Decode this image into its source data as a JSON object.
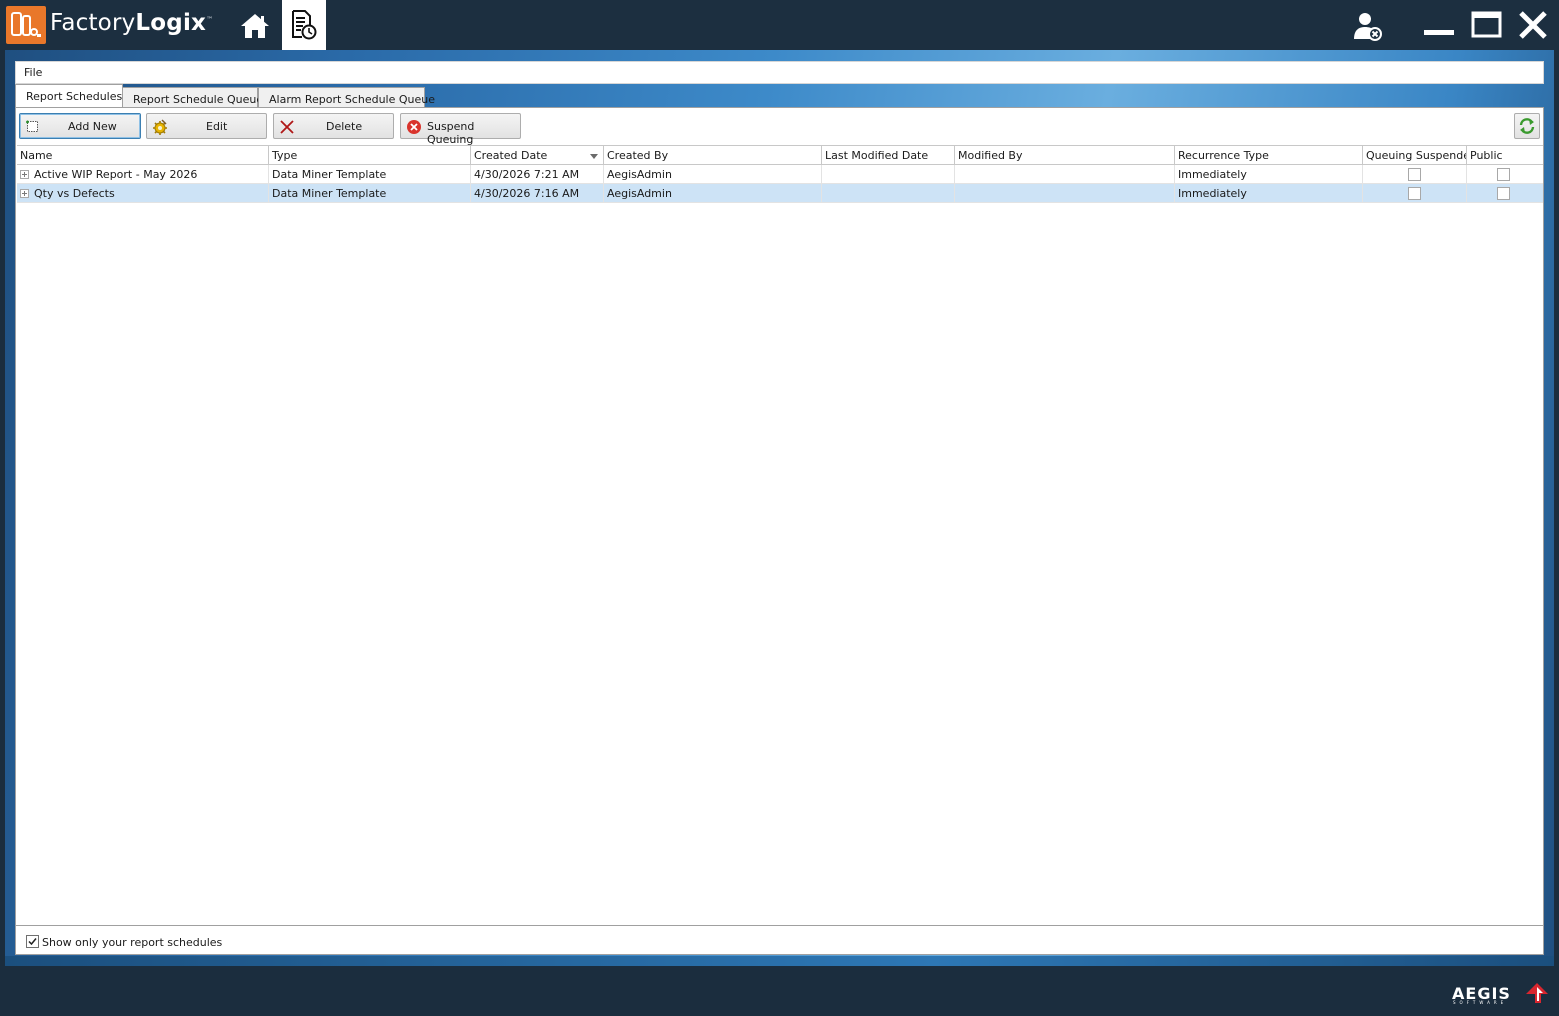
{
  "app": {
    "brand_light": "Factory",
    "brand_bold": "Logix",
    "brand_tm": "™"
  },
  "menu": {
    "file_label": "File"
  },
  "tabs": [
    {
      "label": "Report Schedules",
      "active": true
    },
    {
      "label": "Report Schedule Queue",
      "active": false
    },
    {
      "label": "Alarm Report Schedule Queue",
      "active": false
    }
  ],
  "toolbar": {
    "add_new": "Add New",
    "edit": "Edit",
    "delete": "Delete",
    "suspend_queuing": "Suspend Queuing"
  },
  "grid": {
    "columns": [
      "Name",
      "Type",
      "Created Date",
      "Created By",
      "Last Modified Date",
      "Modified By",
      "Recurrence Type",
      "Queuing Suspended",
      "Public"
    ],
    "sort_column": "Created Date",
    "sort_direction": "descending",
    "rows": [
      {
        "name": "Active WIP Report - May 2026",
        "type": "Data Miner Template",
        "created_date": "4/30/2026 7:21 AM",
        "created_by": "AegisAdmin",
        "last_modified_date": "",
        "modified_by": "",
        "recurrence_type": "Immediately",
        "queuing_suspended": false,
        "public": false,
        "selected": false
      },
      {
        "name": "Qty vs Defects",
        "type": "Data Miner Template",
        "created_date": "4/30/2026 7:16 AM",
        "created_by": "AegisAdmin",
        "last_modified_date": "",
        "modified_by": "",
        "recurrence_type": "Immediately",
        "queuing_suspended": false,
        "public": false,
        "selected": true
      }
    ]
  },
  "footer": {
    "show_only_mine_label": "Show only your report schedules",
    "show_only_mine_checked": true
  },
  "vendor": {
    "name": "AEGIS",
    "sub": "SOFTWARE"
  },
  "colors": {
    "titlebar": "#1c2f40",
    "brand_orange": "#e9772a",
    "selected_row": "#cde3f6",
    "refresh_green": "#3a9a2e",
    "delete_red": "#b01818",
    "aegis_red": "#d8262f"
  }
}
